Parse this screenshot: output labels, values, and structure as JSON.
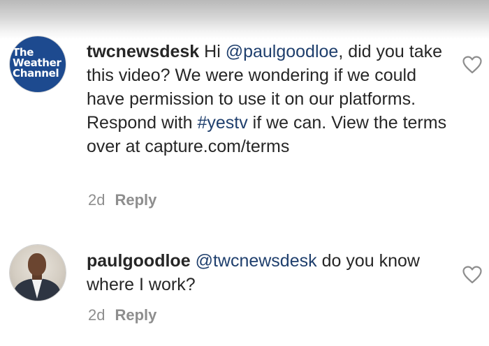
{
  "comments": [
    {
      "username": "twcnewsdesk",
      "avatar_text": "The\nWeather\nChannel",
      "parts": [
        {
          "type": "text",
          "value": " Hi "
        },
        {
          "type": "mention",
          "value": "@paulgoodloe"
        },
        {
          "type": "text",
          "value": ", did you take this video? We were wondering if we could have permission to use it on our platforms. Respond with "
        },
        {
          "type": "hashtag",
          "value": "#yestv"
        },
        {
          "type": "text",
          "value": " if we can. View the terms over at capture.com/terms"
        }
      ],
      "time": "2d",
      "reply_label": "Reply",
      "like_icon": "heart-outline-icon"
    },
    {
      "username": "paulgoodloe",
      "parts": [
        {
          "type": "text",
          "value": " "
        },
        {
          "type": "mention",
          "value": "@twcnewsdesk"
        },
        {
          "type": "text",
          "value": " do you know where I work?"
        }
      ],
      "time": "2d",
      "reply_label": "Reply",
      "like_icon": "heart-outline-icon"
    }
  ],
  "colors": {
    "mention": "#1f3f6d",
    "text": "#262626",
    "meta": "#8e8e8e",
    "twc_blue": "#1d4a8f"
  }
}
